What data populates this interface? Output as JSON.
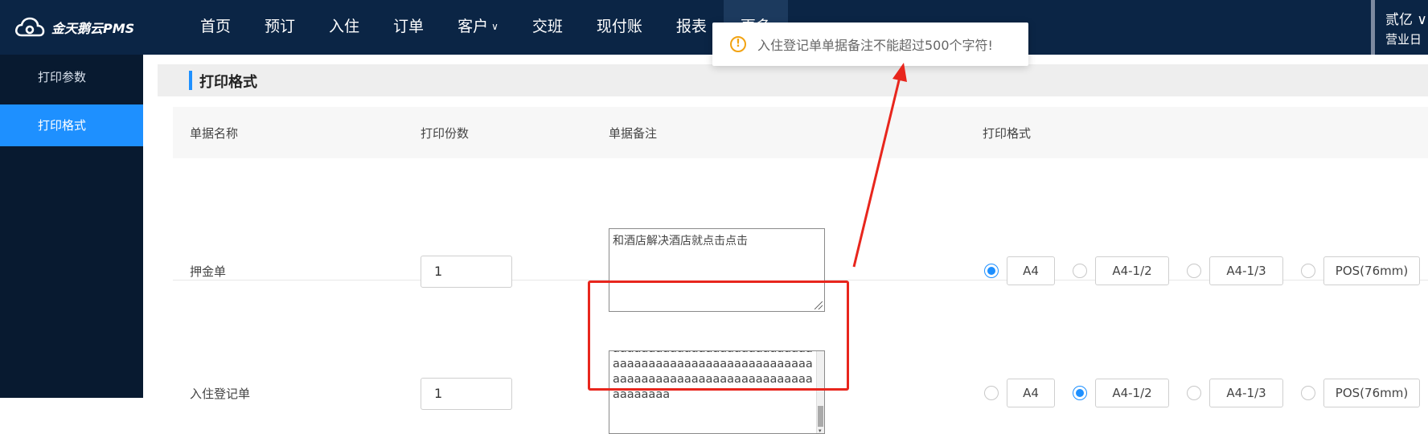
{
  "app": {
    "logo_text": "金天鹅云PMS"
  },
  "nav": [
    {
      "label": "首页"
    },
    {
      "label": "预订"
    },
    {
      "label": "入住"
    },
    {
      "label": "订单"
    },
    {
      "label": "客户",
      "has_dropdown": true
    },
    {
      "label": "交班"
    },
    {
      "label": "现付账"
    },
    {
      "label": "报表"
    },
    {
      "label": "更多"
    }
  ],
  "header": {
    "user": "贰亿 ∨",
    "business_day_label": "营业日"
  },
  "sidebar": {
    "items": [
      {
        "label": "打印参数"
      },
      {
        "label": "打印格式",
        "active": true
      }
    ]
  },
  "section": {
    "title": "打印格式"
  },
  "table": {
    "headers": {
      "name": "单据名称",
      "copies": "打印份数",
      "remark": "单据备注",
      "format": "打印格式"
    },
    "format_options": [
      "A4",
      "A4-1/2",
      "A4-1/3",
      "POS(76mm)"
    ],
    "rows": [
      {
        "name": "押金单",
        "copies": "1",
        "remark": "和酒店解决酒店就点击点击",
        "selected_format": "A4"
      },
      {
        "name": "入住登记单",
        "copies": "1",
        "remark": "aaaaaaaaaaaaaaaaaaaaaaaaaaaaaaaaaaaaaaaaaaaaaaaaaaaaaaaaaaaaaaaaaaaaaaaaaaaaaaaaaaaaaaaaaaaa",
        "selected_format": "A4-1/2"
      }
    ]
  },
  "toast": {
    "icon": "warning-icon",
    "message": "入住登记单单据备注不能超过500个字符!"
  },
  "colors": {
    "topbar": "#0b2545",
    "sidebar": "#081a30",
    "accent": "#1e90ff",
    "annotation": "#e8261d",
    "warning": "#f2a312"
  }
}
